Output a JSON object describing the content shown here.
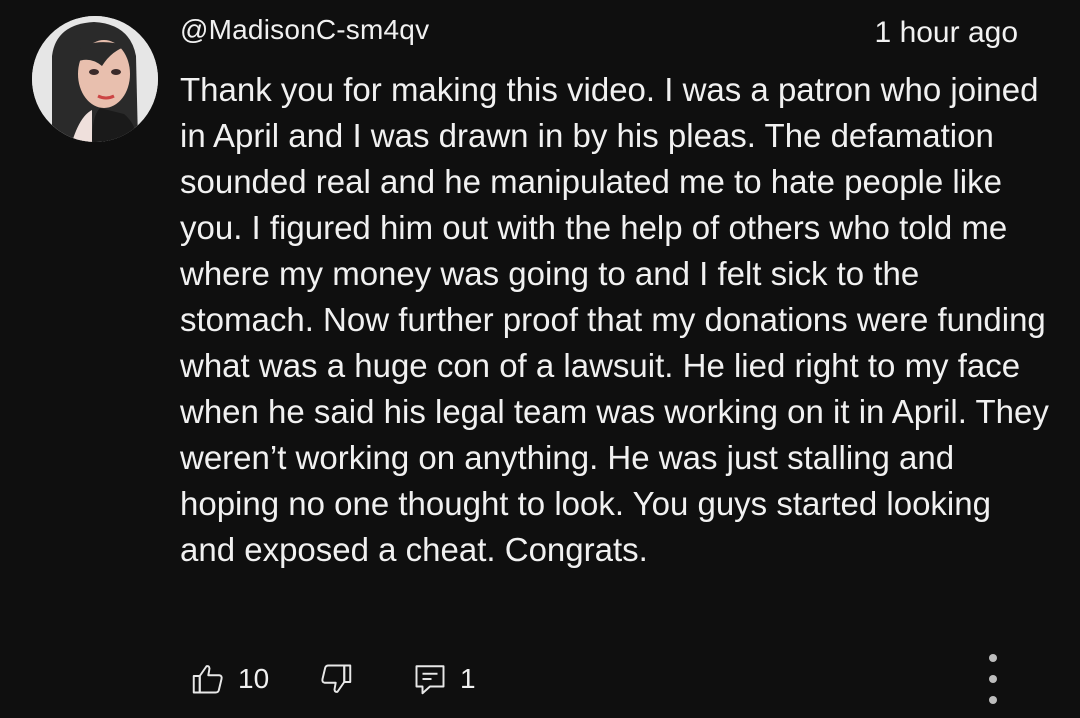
{
  "comment": {
    "author": "@MadisonC-sm4qv",
    "timestamp": "1 hour ago",
    "text": "Thank you for making this video. I was a patron who joined in April and I was drawn in by his pleas. The defamation sounded real and he manipulated me to hate people like you. I figured him out with the help of others who told me where my money was going to and I felt sick to the stomach. Now further proof that my donations were funding what was a huge con of a lawsuit. He lied right to my face when he said his legal team was working on it in April. They weren’t working on anything. He was just stalling and hoping no one thought to look. You guys started looking and exposed a cheat. Congrats."
  },
  "actions": {
    "like_icon": "thumbs-up-icon",
    "like_count": "10",
    "dislike_icon": "thumbs-down-icon",
    "reply_icon": "reply-comment-icon",
    "reply_count": "1",
    "more_icon": "more-vertical-icon"
  },
  "colors": {
    "background": "#0f0f0f",
    "text": "#f1f1f1",
    "icon": "#e8e8e8"
  }
}
